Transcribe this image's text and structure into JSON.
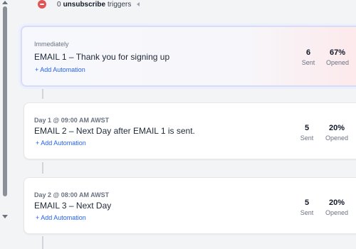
{
  "unsubscribe_row": {
    "count": "0",
    "bold_text": "unsubscribe",
    "rest_text": "triggers"
  },
  "emails": [
    {
      "when": "Immediately",
      "title": "EMAIL 1 – Thank you for signing up",
      "add_label": "+ Add Automation",
      "sent_value": "6",
      "sent_label": "Sent",
      "opened_value": "67%",
      "opened_label": "Opened",
      "selected": true
    },
    {
      "when": "Day 1 @ 09:00 AM AWST",
      "title": "EMAIL 2 – Next Day after EMAIL 1 is sent.",
      "add_label": "+ Add Automation",
      "sent_value": "5",
      "sent_label": "Sent",
      "opened_value": "20%",
      "opened_label": "Opened",
      "selected": false
    },
    {
      "when": "Day 2 @ 08:00 AM AWST",
      "title": "EMAIL 3 – Next Day",
      "add_label": "+ Add Automation",
      "sent_value": "5",
      "sent_label": "Sent",
      "opened_value": "20%",
      "opened_label": "Opened",
      "selected": false
    }
  ],
  "icons": {
    "remove": "minus-circle-icon",
    "collapse": "caret-left-icon",
    "scroll_up": "scroll-up-arrow",
    "scroll_down": "scroll-down-arrow"
  },
  "colors": {
    "accent_link": "#2563eb",
    "remove_red": "#e25555",
    "selected_border": "#d9dcf5"
  }
}
